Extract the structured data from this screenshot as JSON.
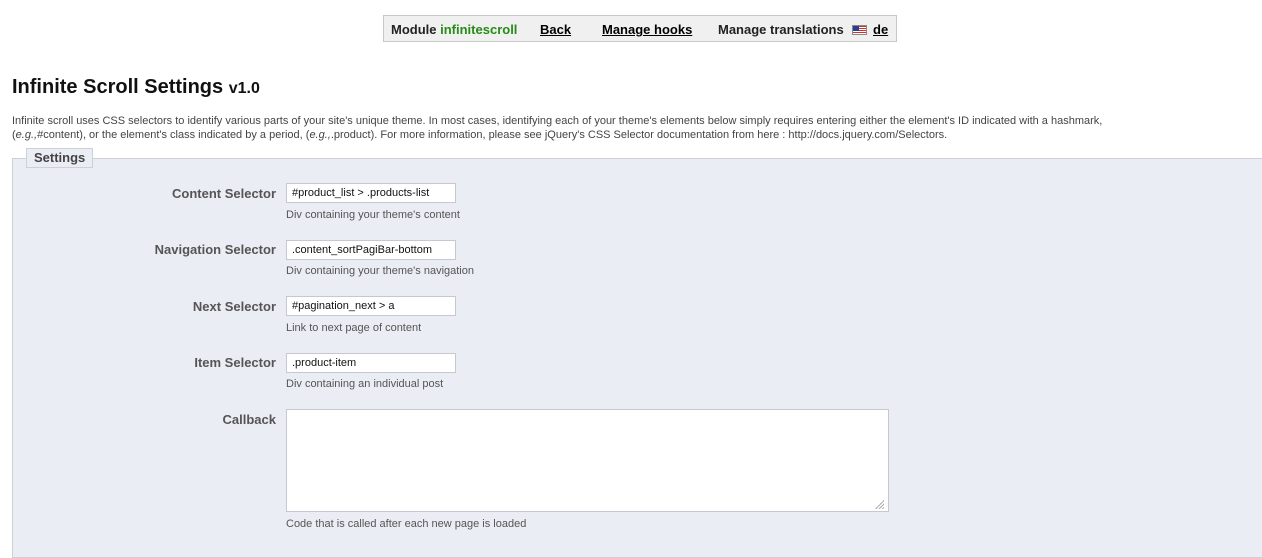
{
  "toolbar": {
    "module_prefix": "Module",
    "module_name": "infinitescroll",
    "back_label": "Back",
    "manage_hooks_label": "Manage hooks",
    "manage_translations_label": "Manage translations",
    "language_flag_icon": "us-flag-icon",
    "language_code": "de"
  },
  "page": {
    "title": "Infinite Scroll Settings",
    "version": "v1.0",
    "intro_part1": "Infinite scroll uses CSS selectors to identify various parts of your site's unique theme. In most cases, identifying each of your theme's elements below simply requires entering either the element's ID indicated with a hashmark,",
    "intro_eg1": "e.g.,",
    "intro_part2": "#content), or the element's class indicated by a period, (",
    "intro_eg2": "e.g.,",
    "intro_part3": ".product). For more information, please see jQuery's CSS Selector documentation from here : http://docs.jquery.com/Selectors."
  },
  "settings": {
    "legend": "Settings",
    "content_selector": {
      "label": "Content Selector",
      "value": "#product_list > .products-list",
      "help": "Div containing your theme's content"
    },
    "navigation_selector": {
      "label": "Navigation Selector",
      "value": ".content_sortPagiBar-bottom",
      "help": "Div containing your theme's navigation"
    },
    "next_selector": {
      "label": "Next Selector",
      "value": "#pagination_next > a",
      "help": "Link to next page of content"
    },
    "item_selector": {
      "label": "Item Selector",
      "value": ".product-item",
      "help": "Div containing an individual post"
    },
    "callback": {
      "label": "Callback",
      "value": "",
      "help": "Code that is called after each new page is loaded"
    }
  }
}
